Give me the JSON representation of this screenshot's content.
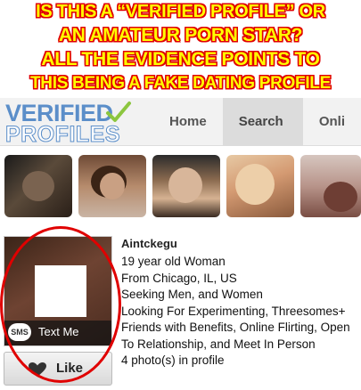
{
  "headline": {
    "line1": "IS THIS A “VERIFIED PROFILE” OR",
    "line2": "AN AMATEUR PORN STAR?",
    "line3": "ALL THE EVIDENCE POINTS TO",
    "line4": "THIS BEING A FAKE DATING PROFILE",
    "text_color": "#ffff00",
    "outline_color": "#e00000"
  },
  "logo": {
    "top": "VERIFIED",
    "bottom": "PROFILES",
    "brand_color": "#5b8ec9",
    "check_color": "#8cc63f"
  },
  "nav": {
    "home": "Home",
    "search": "Search",
    "online": "Onli"
  },
  "profile": {
    "username": "Aintckegu",
    "lines": [
      "19 year old Woman",
      "From Chicago, IL, US",
      "Seeking Men, and Women",
      "Looking For Experimenting, Threesomes+",
      "Friends with Benefits, Online Flirting, Open",
      "To Relationship, and Meet In Person",
      "4 photo(s) in profile"
    ],
    "sms_icon": "SMS",
    "sms_label": "Text Me",
    "like_label": "Like"
  },
  "annotation_color": "#e00000"
}
